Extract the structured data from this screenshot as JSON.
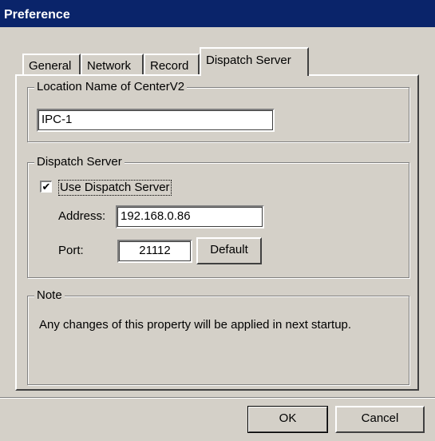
{
  "window": {
    "title": "Preference"
  },
  "tabs": [
    {
      "label": "General"
    },
    {
      "label": "Network"
    },
    {
      "label": "Record"
    },
    {
      "label": "Dispatch Server"
    }
  ],
  "location": {
    "group_label": "Location Name of CenterV2",
    "value": "IPC-1"
  },
  "dispatch": {
    "group_label": "Dispatch Server",
    "use_label": "Use Dispatch Server",
    "use_checked": true,
    "checkmark": "✔",
    "address_label": "Address:",
    "address_value": "192.168.0.86",
    "port_label": "Port:",
    "port_value": "21112",
    "default_label": "Default"
  },
  "note": {
    "group_label": "Note",
    "text": "Any changes of this property will be applied in next startup."
  },
  "footer": {
    "ok_label": "OK",
    "cancel_label": "Cancel"
  }
}
